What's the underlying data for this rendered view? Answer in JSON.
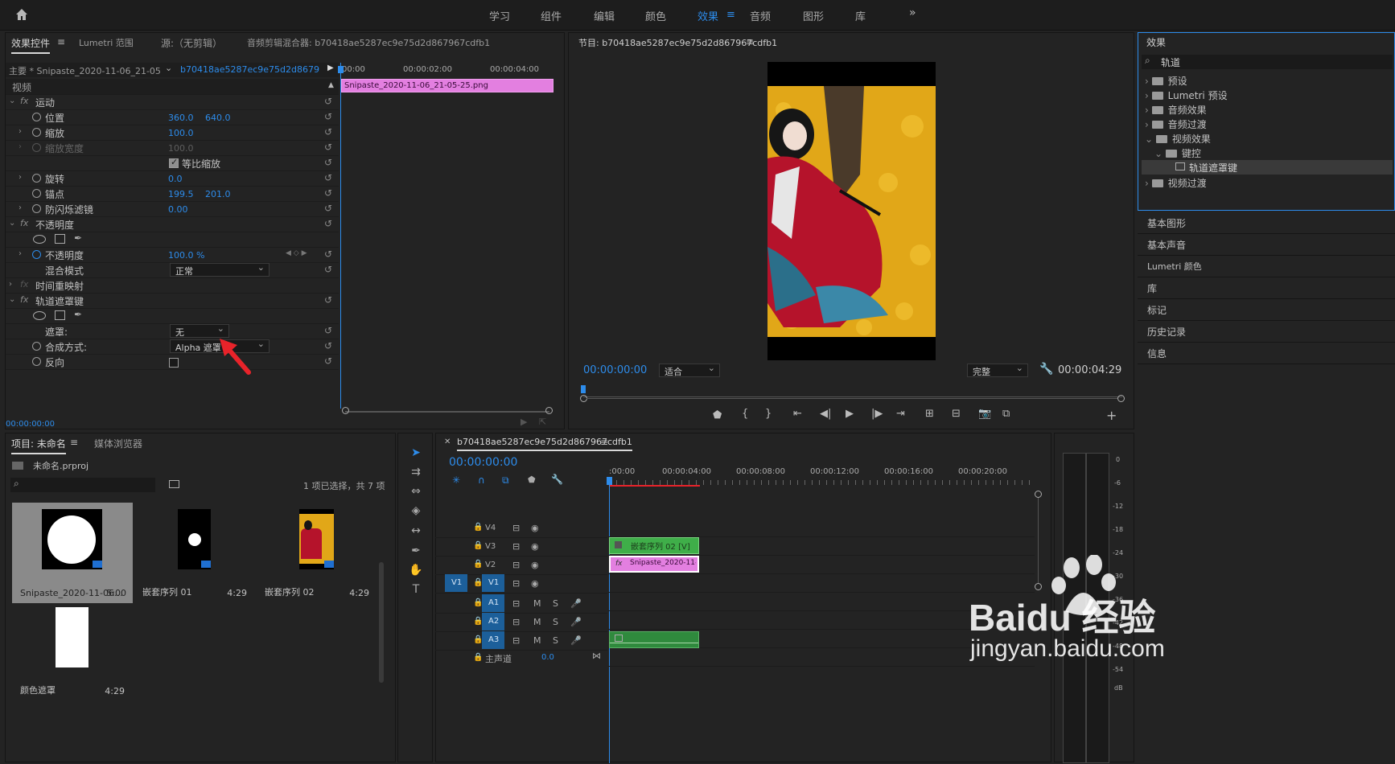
{
  "top_bar": {
    "home_icon": "home-icon",
    "workspaces": [
      "学习",
      "组件",
      "编辑",
      "颜色",
      "效果",
      "音频",
      "图形",
      "库"
    ],
    "active_workspace": "效果",
    "more_icon": "double-chevron-right-icon"
  },
  "effect_controls": {
    "tabs": [
      "效果控件",
      "Lumetri 范围",
      "源:（无剪辑）",
      "音频剪辑混合器: b70418ae5287ec9e75d2d867967cdfb1"
    ],
    "master_clip": "主要 * Snipaste_2020-11-06_21-05-25...",
    "sequence_clip": "b70418ae5287ec9e75d2d867967cdfb...",
    "ruler": [
      "00:00",
      "00:00:02:00",
      "00:00:04:00"
    ],
    "clip_bar_label": "Snipaste_2020-11-06_21-05-25.png",
    "section_video": "视频",
    "motion": "运动",
    "position": {
      "label": "位置",
      "x": "360.0",
      "y": "640.0"
    },
    "scale": {
      "label": "缩放",
      "value": "100.0"
    },
    "scale_width": {
      "label": "缩放宽度",
      "value": "100.0"
    },
    "uniform_scale": "等比缩放",
    "rotation": {
      "label": "旋转",
      "value": "0.0"
    },
    "anchor": {
      "label": "锚点",
      "x": "199.5",
      "y": "201.0"
    },
    "anti_flicker": {
      "label": "防闪烁滤镜",
      "value": "0.00"
    },
    "opacity_group": "不透明度",
    "opacity": {
      "label": "不透明度",
      "value": "100.0 %"
    },
    "blend_mode": {
      "label": "混合模式",
      "value": "正常"
    },
    "time_remap": "时间重映射",
    "track_matte": "轨道遮罩键",
    "matte": {
      "label": "遮罩:",
      "value": "无"
    },
    "composite": {
      "label": "合成方式:",
      "value": "Alpha 遮罩"
    },
    "reverse": {
      "label": "反向"
    },
    "timecode": "00:00:00:00"
  },
  "program_monitor": {
    "title": "节目: b70418ae5287ec9e75d2d867967cdfb1",
    "timecode": "00:00:00:00",
    "fit": "适合",
    "quality": "完整",
    "duration": "00:00:04:29"
  },
  "effects_panel": {
    "title": "效果",
    "search_value": "轨道",
    "tree": [
      "预设",
      "Lumetri 预设",
      "音频效果",
      "音频过渡",
      "视频效果",
      "键控",
      "轨道遮罩键",
      "视频过渡"
    ],
    "side_panels": [
      "基本图形",
      "基本声音",
      "Lumetri 颜色",
      "库",
      "标记",
      "历史记录",
      "信息"
    ]
  },
  "project": {
    "tabs": [
      "项目: 未命名",
      "媒体浏览器"
    ],
    "file": "未命名.prproj",
    "selection": "1 项已选择，共 7 项",
    "items": [
      {
        "name": "Snipaste_2020-11-06...",
        "duration": "5:00"
      },
      {
        "name": "嵌套序列 01",
        "duration": "4:29"
      },
      {
        "name": "嵌套序列 02",
        "duration": "4:29"
      },
      {
        "name": "颜色遮罩",
        "duration": "4:29"
      }
    ]
  },
  "timeline": {
    "title": "b70418ae5287ec9e75d2d867967cdfb1",
    "timecode": "00:00:00:00",
    "ruler": [
      ":00:00",
      "00:00:04:00",
      "00:00:08:00",
      "00:00:12:00",
      "00:00:16:00",
      "00:00:20:00"
    ],
    "video_tracks": [
      "V4",
      "V3",
      "V2",
      "V1"
    ],
    "audio_tracks": [
      "A1",
      "A2",
      "A3"
    ],
    "source_v1": "V1",
    "master": "主声道",
    "master_value": "0.0",
    "clip_v3": "嵌套序列 02 [V]",
    "clip_v2": "Snipaste_2020-11-06",
    "meter_scale": [
      "0",
      "-6",
      "-12",
      "-18",
      "-24",
      "-30",
      "-36",
      "-42",
      "-48",
      "-54",
      "dB"
    ]
  },
  "watermark": {
    "brand": "Baidu 经验",
    "url": "jingyan.baidu.com"
  }
}
